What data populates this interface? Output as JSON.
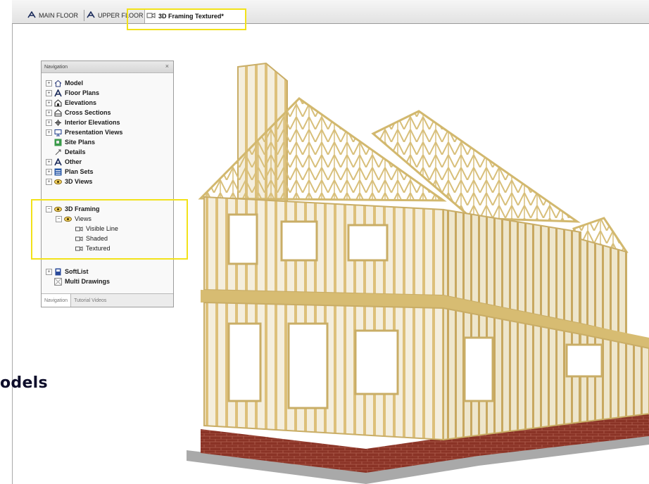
{
  "tabs": [
    {
      "label": "MAIN FLOOR",
      "icon": "floor-plan-icon",
      "active": false
    },
    {
      "label": "UPPER FLOOR",
      "icon": "floor-plan-icon",
      "active": false
    },
    {
      "label": "3D Framing Textured*",
      "icon": "camera-3d-icon",
      "active": true
    }
  ],
  "navigation": {
    "title": "Navigation",
    "close": "×",
    "items": [
      {
        "label": "Model",
        "icon": "model-house-icon"
      },
      {
        "label": "Floor Plans",
        "icon": "floor-plan-icon"
      },
      {
        "label": "Elevations",
        "icon": "elevation-icon"
      },
      {
        "label": "Cross Sections",
        "icon": "cross-section-icon"
      },
      {
        "label": "Interior Elevations",
        "icon": "interior-elevation-icon"
      },
      {
        "label": "Presentation Views",
        "icon": "presentation-icon"
      },
      {
        "label": "Site Plans",
        "icon": "site-plan-icon"
      },
      {
        "label": "Details",
        "icon": "details-icon"
      },
      {
        "label": "Other",
        "icon": "other-icon"
      },
      {
        "label": "Plan Sets",
        "icon": "plan-sets-icon"
      },
      {
        "label": "3D Views",
        "icon": "eye-icon"
      }
    ],
    "framing": {
      "label": "3D Framing",
      "views_label": "Views",
      "views": [
        "Visible Line",
        "Shaded",
        "Textured"
      ]
    },
    "bottom_items": [
      {
        "label": "SoftList",
        "icon": "softlist-icon"
      },
      {
        "label": "Multi Drawings",
        "icon": "multi-drawings-icon"
      }
    ],
    "bottom_tabs": [
      "Navigation",
      "Tutorial Videos"
    ]
  },
  "caption": "odels",
  "colors": {
    "highlight": "#f2e21a",
    "lumber": "#e2cc8a",
    "brick": "#8a3326",
    "foundation": "#a9a9a9"
  }
}
